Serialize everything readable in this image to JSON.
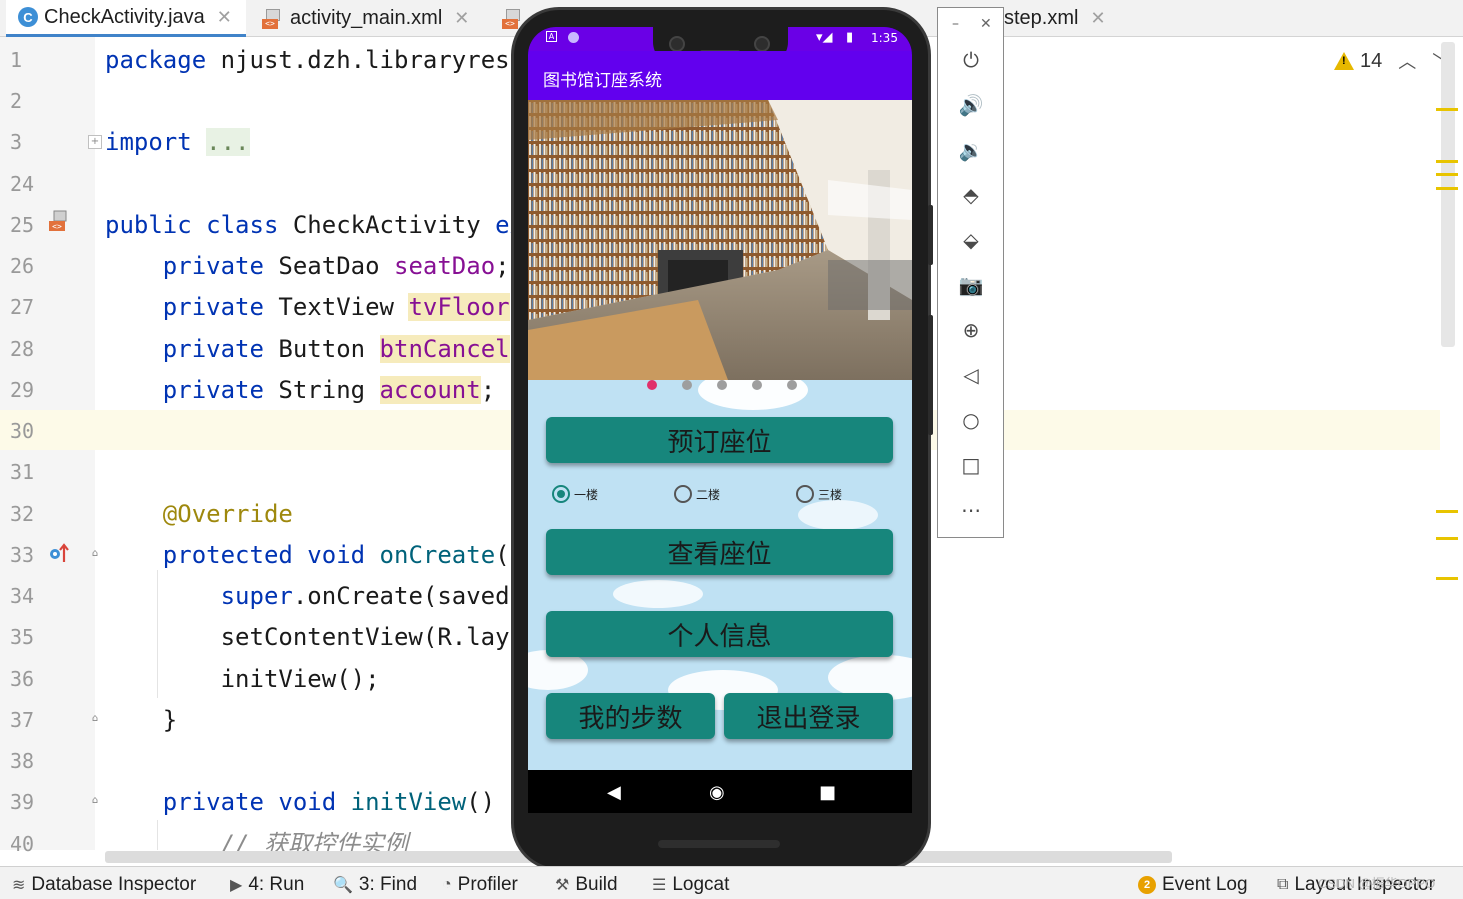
{
  "tabs": [
    {
      "label": "CheckActivity.java",
      "icon": "java-class-icon",
      "active": true
    },
    {
      "label": "activity_main.xml",
      "icon": "xml-layout-icon",
      "active": false
    },
    {
      "label": "step.xml",
      "icon": "xml-layout-icon",
      "active": false,
      "partially_hidden": true
    }
  ],
  "editor": {
    "lines": [
      {
        "num": "1",
        "text": "package njust.dzh.libraryrese"
      },
      {
        "num": "2",
        "text": ""
      },
      {
        "num": "3",
        "text": "import ..."
      },
      {
        "num": "24",
        "text": ""
      },
      {
        "num": "25",
        "text": "public class CheckActivity ex"
      },
      {
        "num": "26",
        "text": "    private SeatDao seatDao;"
      },
      {
        "num": "27",
        "text": "    private TextView tvFloor,"
      },
      {
        "num": "28",
        "text": "    private Button btnCancel;"
      },
      {
        "num": "29",
        "text": "    private String account;"
      },
      {
        "num": "30",
        "text": ""
      },
      {
        "num": "31",
        "text": ""
      },
      {
        "num": "32",
        "text": "    @Override"
      },
      {
        "num": "33",
        "text": "    protected void onCreate(B"
      },
      {
        "num": "34",
        "text": "        super.onCreate(savedI"
      },
      {
        "num": "35",
        "text": "        setContentView(R.layo"
      },
      {
        "num": "36",
        "text": "        initView();"
      },
      {
        "num": "37",
        "text": "    }"
      },
      {
        "num": "38",
        "text": ""
      },
      {
        "num": "39",
        "text": "    private void initView() {"
      },
      {
        "num": "40",
        "text": "        // 获取控件实例"
      }
    ],
    "warning_count": "14",
    "current_line": "30"
  },
  "phone": {
    "status_time": "1:35",
    "app_title": "图书馆订座系统",
    "banner_icon": "library-photo",
    "carousel_dots": 5,
    "carousel_active": 0,
    "buttons": {
      "reserve": "预订座位",
      "view": "查看座位",
      "profile": "个人信息",
      "steps": "我的步数",
      "logout": "退出登录"
    },
    "floors": [
      {
        "label": "一楼",
        "checked": true
      },
      {
        "label": "二楼",
        "checked": false
      },
      {
        "label": "三楼",
        "checked": false
      }
    ]
  },
  "emulator_controls": [
    "power-icon",
    "volume-up-icon",
    "volume-down-icon",
    "rotate-left-icon",
    "rotate-right-icon",
    "camera-icon",
    "zoom-icon",
    "back-icon",
    "home-icon",
    "overview-icon",
    "more-icon"
  ],
  "bottom_bar": {
    "database_inspector": "Database Inspector",
    "run": "4: Run",
    "find": "3: Find",
    "profiler": "Profiler",
    "build": "Build",
    "logcat": "Logcat",
    "event_log": "Event Log",
    "event_log_count": "2",
    "layout_inspector": "Layout Inspector"
  },
  "watermark": "CSDN @振华OPPO",
  "colors": {
    "keyword": "#0033b3",
    "field": "#871094",
    "annotation": "#9e880d",
    "app_bar": "#6200ee",
    "button": "#17867c",
    "content_bg": "#bfe1f3",
    "carousel_active_dot": "#e0306b"
  }
}
